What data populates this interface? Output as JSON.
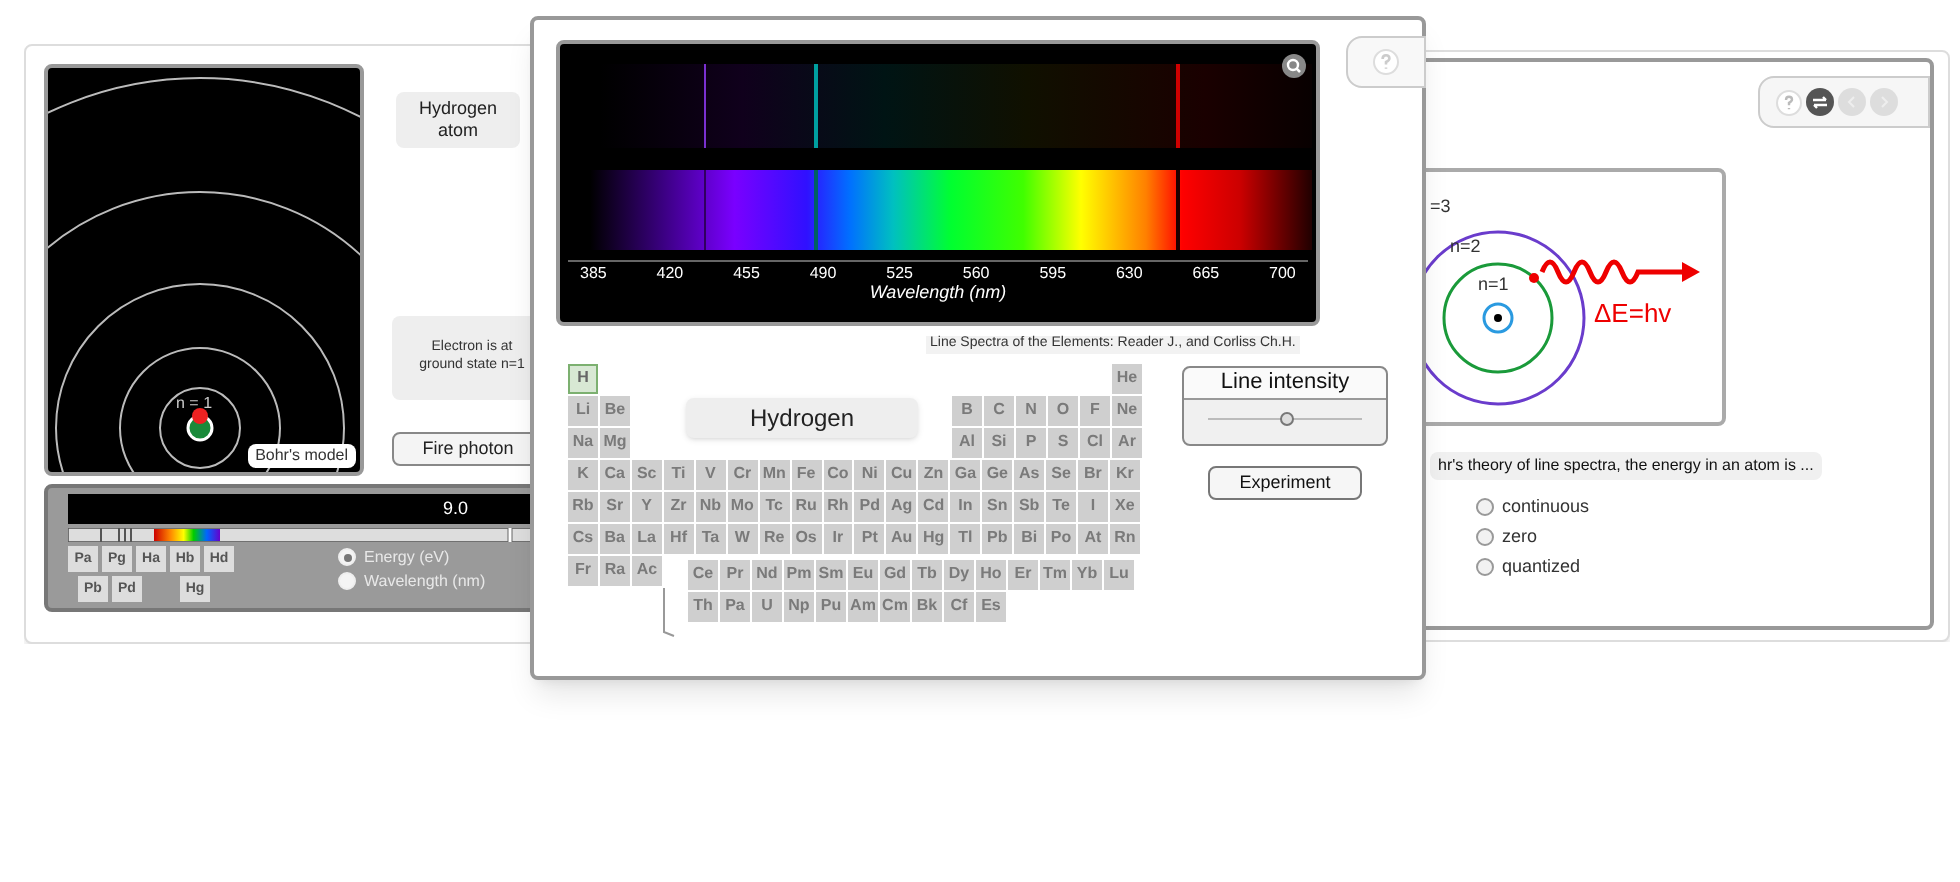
{
  "left_window": {
    "orbit_label": "n = 1",
    "model_label": "Bohr's model",
    "atom_button": "Hydrogen atom",
    "status_text": "Electron is at ground state n=1",
    "fire_button": "Fire photon",
    "energy_readout": "9.0",
    "series_rows": [
      [
        {
          "label": "Pa"
        },
        {
          "label": "Pg"
        },
        {
          "label": "Ha"
        },
        {
          "label": "Hb"
        },
        {
          "label": "Hd"
        }
      ],
      [
        {
          "label": "Pb"
        },
        {
          "label": "Pd"
        },
        {
          "label": "Hg"
        }
      ]
    ],
    "units": [
      {
        "label": "Energy (eV)",
        "selected": true
      },
      {
        "label": "Wavelength (nm)",
        "selected": false
      }
    ]
  },
  "spectrum_window": {
    "ticks": [
      "385",
      "420",
      "455",
      "490",
      "525",
      "560",
      "595",
      "630",
      "665",
      "700"
    ],
    "axis_label": "Wavelength (nm)",
    "caption": "Line Spectra of the Elements: Reader J., and Corliss Ch.H.",
    "element_name": "Hydrogen",
    "periodic_table": [
      {
        "left": [
          {
            "symbol": "H",
            "selected": true
          }
        ],
        "right": [
          {
            "symbol": "He",
            "selected": false
          }
        ]
      },
      {
        "left": [
          {
            "symbol": "Li",
            "selected": false
          },
          {
            "symbol": "Be",
            "selected": false
          }
        ],
        "right": [
          {
            "symbol": "B",
            "selected": false
          },
          {
            "symbol": "C",
            "selected": false
          },
          {
            "symbol": "N",
            "selected": false
          },
          {
            "symbol": "O",
            "selected": false
          },
          {
            "symbol": "F",
            "selected": false
          },
          {
            "symbol": "Ne",
            "selected": false
          }
        ]
      },
      {
        "left": [
          {
            "symbol": "Na",
            "selected": false
          },
          {
            "symbol": "Mg",
            "selected": false
          }
        ],
        "right": [
          {
            "symbol": "Al",
            "selected": false
          },
          {
            "symbol": "Si",
            "selected": false
          },
          {
            "symbol": "P",
            "selected": false
          },
          {
            "symbol": "S",
            "selected": false
          },
          {
            "symbol": "Cl",
            "selected": false
          },
          {
            "symbol": "Ar",
            "selected": false
          }
        ]
      },
      {
        "left": [
          {
            "symbol": "K",
            "selected": false
          },
          {
            "symbol": "Ca",
            "selected": false
          },
          {
            "symbol": "Sc",
            "selected": false
          },
          {
            "symbol": "Ti",
            "selected": false
          },
          {
            "symbol": "V",
            "selected": false
          },
          {
            "symbol": "Cr",
            "selected": false
          },
          {
            "symbol": "Mn",
            "selected": false
          },
          {
            "symbol": "Fe",
            "selected": false
          },
          {
            "symbol": "Co",
            "selected": false
          },
          {
            "symbol": "Ni",
            "selected": false
          },
          {
            "symbol": "Cu",
            "selected": false
          },
          {
            "symbol": "Zn",
            "selected": false
          },
          {
            "symbol": "Ga",
            "selected": false
          },
          {
            "symbol": "Ge",
            "selected": false
          },
          {
            "symbol": "As",
            "selected": false
          },
          {
            "symbol": "Se",
            "selected": false
          },
          {
            "symbol": "Br",
            "selected": false
          },
          {
            "symbol": "Kr",
            "selected": false
          }
        ]
      },
      {
        "left": [
          {
            "symbol": "Rb",
            "selected": false
          },
          {
            "symbol": "Sr",
            "selected": false
          },
          {
            "symbol": "Y",
            "selected": false
          },
          {
            "symbol": "Zr",
            "selected": false
          },
          {
            "symbol": "Nb",
            "selected": false
          },
          {
            "symbol": "Mo",
            "selected": false
          },
          {
            "symbol": "Tc",
            "selected": false
          },
          {
            "symbol": "Ru",
            "selected": false
          },
          {
            "symbol": "Rh",
            "selected": false
          },
          {
            "symbol": "Pd",
            "selected": false
          },
          {
            "symbol": "Ag",
            "selected": false
          },
          {
            "symbol": "Cd",
            "selected": false
          },
          {
            "symbol": "In",
            "selected": false
          },
          {
            "symbol": "Sn",
            "selected": false
          },
          {
            "symbol": "Sb",
            "selected": false
          },
          {
            "symbol": "Te",
            "selected": false
          },
          {
            "symbol": "I",
            "selected": false
          },
          {
            "symbol": "Xe",
            "selected": false
          }
        ]
      },
      {
        "left": [
          {
            "symbol": "Cs",
            "selected": false
          },
          {
            "symbol": "Ba",
            "selected": false
          },
          {
            "symbol": "La",
            "selected": false
          },
          {
            "symbol": "Hf",
            "selected": false
          },
          {
            "symbol": "Ta",
            "selected": false
          },
          {
            "symbol": "W",
            "selected": false
          },
          {
            "symbol": "Re",
            "selected": false
          },
          {
            "symbol": "Os",
            "selected": false
          },
          {
            "symbol": "Ir",
            "selected": false
          },
          {
            "symbol": "Pt",
            "selected": false
          },
          {
            "symbol": "Au",
            "selected": false
          },
          {
            "symbol": "Hg",
            "selected": false
          },
          {
            "symbol": "Tl",
            "selected": false
          },
          {
            "symbol": "Pb",
            "selected": false
          },
          {
            "symbol": "Bi",
            "selected": false
          },
          {
            "symbol": "Po",
            "selected": false
          },
          {
            "symbol": "At",
            "selected": false
          },
          {
            "symbol": "Rn",
            "selected": false
          }
        ]
      },
      {
        "left": [
          {
            "symbol": "Fr",
            "selected": false
          },
          {
            "symbol": "Ra",
            "selected": false
          },
          {
            "symbol": "Ac",
            "selected": false
          }
        ]
      }
    ],
    "f_block": [
      [
        {
          "symbol": "Ce",
          "selected": false
        },
        {
          "symbol": "Pr",
          "selected": false
        },
        {
          "symbol": "Nd",
          "selected": false
        },
        {
          "symbol": "Pm",
          "selected": false
        },
        {
          "symbol": "Sm",
          "selected": false
        },
        {
          "symbol": "Eu",
          "selected": false
        },
        {
          "symbol": "Gd",
          "selected": false
        },
        {
          "symbol": "Tb",
          "selected": false
        },
        {
          "symbol": "Dy",
          "selected": false
        },
        {
          "symbol": "Ho",
          "selected": false
        },
        {
          "symbol": "Er",
          "selected": false
        },
        {
          "symbol": "Tm",
          "selected": false
        },
        {
          "symbol": "Yb",
          "selected": false
        },
        {
          "symbol": "Lu",
          "selected": false
        }
      ],
      [
        {
          "symbol": "Th",
          "selected": false
        },
        {
          "symbol": "Pa",
          "selected": false
        },
        {
          "symbol": "U",
          "selected": false
        },
        {
          "symbol": "Np",
          "selected": false
        },
        {
          "symbol": "Pu",
          "selected": false
        },
        {
          "symbol": "Am",
          "selected": false
        },
        {
          "symbol": "Cm",
          "selected": false
        },
        {
          "symbol": "Bk",
          "selected": false
        },
        {
          "symbol": "Cf",
          "selected": false
        },
        {
          "symbol": "Es",
          "selected": false
        }
      ]
    ],
    "line_intensity": {
      "title": "Line intensity",
      "level": 0.5
    },
    "experiment_button": "Experiment"
  },
  "quiz_window": {
    "labels": {
      "outer": "=3",
      "middle": "n=2",
      "inner": "n=1",
      "equation": "ΔE=hv"
    },
    "question": "hr's theory of line spectra, the energy in an atom is ...",
    "options": [
      {
        "label": "continuous",
        "selected": false
      },
      {
        "label": "zero",
        "selected": false
      },
      {
        "label": "quantized",
        "selected": false
      }
    ]
  }
}
